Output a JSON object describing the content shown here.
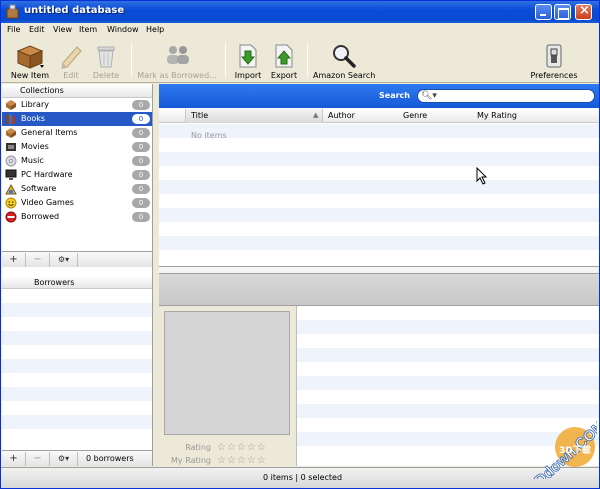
{
  "window": {
    "title": "untitled database"
  },
  "menu": [
    "File",
    "Edit",
    "View",
    "Item",
    "Window",
    "Help"
  ],
  "toolbar": {
    "new_item": "New Item",
    "edit": "Edit",
    "delete": "Delete",
    "mark_borrowed": "Mark as Borrowed...",
    "import": "Import",
    "export": "Export",
    "amazon_search": "Amazon Search",
    "preferences": "Preferences"
  },
  "collections": {
    "header": "Collections",
    "items": [
      {
        "name": "Library",
        "count": "0",
        "icon": "library-icon",
        "selected": false
      },
      {
        "name": "Books",
        "count": "0",
        "icon": "books-icon",
        "selected": true
      },
      {
        "name": "General Items",
        "count": "0",
        "icon": "box-icon",
        "selected": false
      },
      {
        "name": "Movies",
        "count": "0",
        "icon": "film-icon",
        "selected": false
      },
      {
        "name": "Music",
        "count": "0",
        "icon": "cd-icon",
        "selected": false
      },
      {
        "name": "PC Hardware",
        "count": "0",
        "icon": "monitor-icon",
        "selected": false
      },
      {
        "name": "Software",
        "count": "0",
        "icon": "software-icon",
        "selected": false
      },
      {
        "name": "Video Games",
        "count": "0",
        "icon": "smiley-icon",
        "selected": false
      },
      {
        "name": "Borrowed",
        "count": "0",
        "icon": "no-entry-icon",
        "selected": false
      }
    ]
  },
  "pane_buttons": {
    "add": "+",
    "remove": "−",
    "gear": "⚙▾"
  },
  "borrowers": {
    "header": "Borrowers",
    "count_label": "0 borrowers"
  },
  "search": {
    "label": "Search",
    "placeholder": ""
  },
  "table": {
    "columns": [
      "Title",
      "Author",
      "Genre",
      "My Rating"
    ],
    "empty_text": "No items"
  },
  "detail": {
    "rating_label": "Rating",
    "my_rating_label": "My Rating",
    "stars": "☆☆☆☆☆"
  },
  "status": {
    "text": "0 items | 0 selected"
  },
  "watermark": {
    "text": "3Ddown.COM",
    "badge": "3D下载"
  },
  "colors": {
    "selection": "#2659C5",
    "search_bar": "#1559D6",
    "titlebar": "#0A4CD8"
  }
}
